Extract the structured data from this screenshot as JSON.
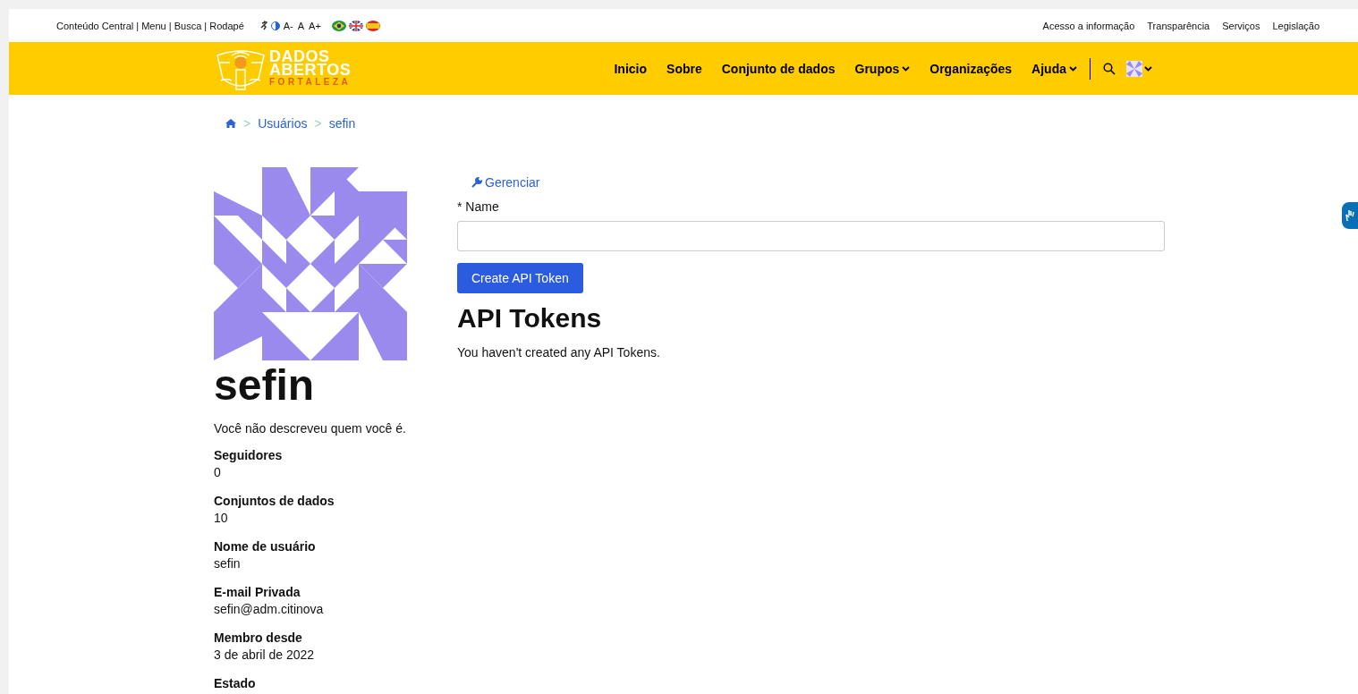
{
  "topbar": {
    "skip_links": "Conteúdo Central | Menu | Busca | Rodapé",
    "font_controls": [
      "A-",
      "A",
      "A+"
    ],
    "links": [
      "Acesso a informação",
      "Transparência",
      "Serviços",
      "Legislação"
    ]
  },
  "logo": {
    "line1": "DADOS",
    "line2": "ABERTOS",
    "line3": "FORTALEZA"
  },
  "nav": [
    {
      "label": "Inicio",
      "dropdown": false
    },
    {
      "label": "Sobre",
      "dropdown": false
    },
    {
      "label": "Conjunto de dados",
      "dropdown": false
    },
    {
      "label": "Grupos",
      "dropdown": true
    },
    {
      "label": "Organizações",
      "dropdown": false
    },
    {
      "label": "Ajuda",
      "dropdown": true
    }
  ],
  "breadcrumb": {
    "separators": [
      ">",
      ">"
    ],
    "items": [
      "Usuários",
      "sefin"
    ]
  },
  "profile": {
    "name": "sefin",
    "about": "Você não descreveu quem você é.",
    "fields": [
      {
        "label": "Seguidores",
        "value": "0"
      },
      {
        "label": "Conjuntos de dados",
        "value": "10"
      },
      {
        "label": "Nome de usuário",
        "value": "sefin"
      },
      {
        "label": "E-mail Privada",
        "value": "sefin@adm.citinova"
      },
      {
        "label": "Membro desde",
        "value": "3 de abril de 2022"
      },
      {
        "label": "Estado"
      }
    ]
  },
  "main": {
    "manage_link": "Gerenciar",
    "name_label": "* Name",
    "create_button": "Create API Token",
    "heading": "API Tokens",
    "empty_message": "You haven't created any API Tokens."
  }
}
